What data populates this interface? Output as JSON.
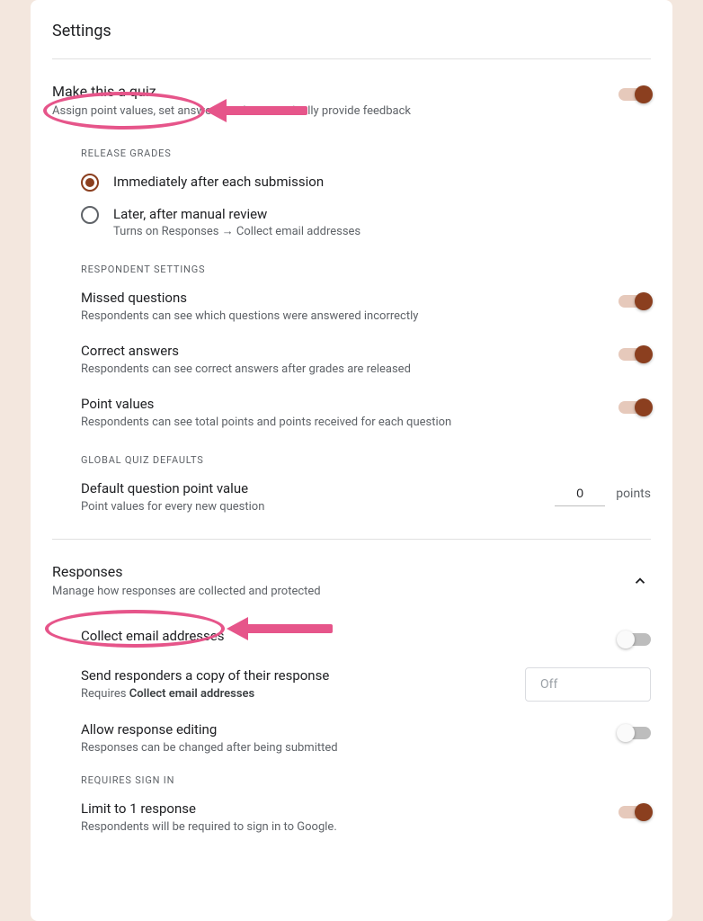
{
  "page_title": "Settings",
  "quiz": {
    "heading": "Make this a quiz",
    "desc": "Assign point values, set answers, and automatically provide feedback",
    "toggle_on": true,
    "release_grades": {
      "label": "RELEASE GRADES",
      "options": [
        {
          "label": "Immediately after each submission",
          "secondary": "",
          "checked": true
        },
        {
          "label": "Later, after manual review",
          "secondary": "Turns on Responses → Collect email addresses",
          "checked": false
        }
      ]
    },
    "respondent_settings": {
      "label": "RESPONDENT SETTINGS",
      "items": [
        {
          "title": "Missed questions",
          "desc": "Respondents can see which questions were answered incorrectly",
          "on": true
        },
        {
          "title": "Correct answers",
          "desc": "Respondents can see correct answers after grades are released",
          "on": true
        },
        {
          "title": "Point values",
          "desc": "Respondents can see total points and points received for each question",
          "on": true
        }
      ]
    },
    "global_defaults": {
      "label": "GLOBAL QUIZ DEFAULTS",
      "title": "Default question point value",
      "desc": "Point values for every new question",
      "value": "0",
      "unit": "points"
    }
  },
  "responses": {
    "heading": "Responses",
    "desc": "Manage how responses are collected and protected",
    "collect_email": {
      "title": "Collect email addresses",
      "on": false
    },
    "send_copy": {
      "title": "Send responders a copy of their response",
      "desc_prefix": "Requires ",
      "desc_strong": "Collect email addresses",
      "dropdown": "Off"
    },
    "allow_edit": {
      "title": "Allow response editing",
      "desc": "Responses can be changed after being submitted",
      "on": false
    },
    "requires_signin": {
      "label": "REQUIRES SIGN IN",
      "limit": {
        "title": "Limit to 1 response",
        "desc": "Respondents will be required to sign in to Google.",
        "on": true
      }
    }
  }
}
